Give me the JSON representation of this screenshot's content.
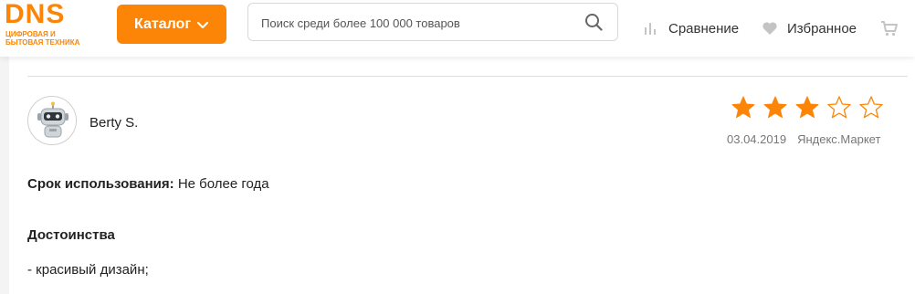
{
  "header": {
    "logo_text": "DNS",
    "logo_subtitle": "ЦИФРОВАЯ И БЫТОВАЯ ТЕХНИКА",
    "catalog_label": "Каталог",
    "search_placeholder": "Поиск среди более 100 000 товаров",
    "compare_label": "Сравнение",
    "favorites_label": "Избранное",
    "cart_label": "",
    "icons": {
      "catalog": "chevron-down-icon",
      "search": "search-icon",
      "compare": "bar-chart-icon",
      "favorites": "heart-icon",
      "cart": "cart-icon"
    }
  },
  "review": {
    "author": "Berty S.",
    "rating": 3,
    "rating_max": 5,
    "date": "03.04.2019",
    "source": "Яндекс.Маркет",
    "usage_label": "Срок использования:",
    "usage_value": "Не более года",
    "pros_title": "Достоинства",
    "pros_items": [
      "- красивый дизайн;"
    ]
  },
  "colors": {
    "brand": "#fc8507",
    "star_filled": "#fc8507",
    "star_empty_stroke": "#fc8507",
    "icon_gray": "#bdbdbd"
  }
}
